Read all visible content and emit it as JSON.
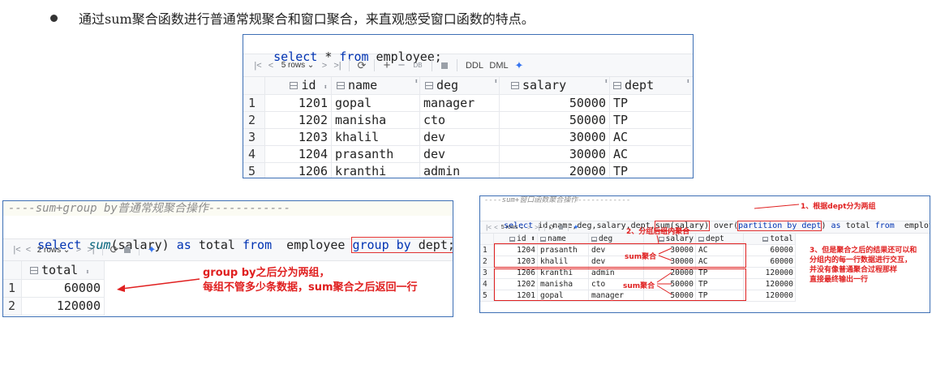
{
  "intro": "通过sum聚合函数进行普通常规聚合和窗口聚合，来直观感受窗口函数的特点。",
  "top": {
    "sql": [
      "select",
      " * ",
      "from",
      " employee;"
    ],
    "toolbar": {
      "rows": "5 rows",
      "ddl": "DDL",
      "dml": "DML"
    },
    "columns": [
      "id",
      "name",
      "deg",
      "salary",
      "dept"
    ],
    "rows": [
      [
        "1",
        "1201",
        "gopal",
        "manager",
        "50000",
        "TP"
      ],
      [
        "2",
        "1202",
        "manisha",
        "cto",
        "50000",
        "TP"
      ],
      [
        "3",
        "1203",
        "khalil",
        "dev",
        "30000",
        "AC"
      ],
      [
        "4",
        "1204",
        "prasanth",
        "dev",
        "30000",
        "AC"
      ],
      [
        "5",
        "1206",
        "kranthi",
        "admin",
        "20000",
        "TP"
      ]
    ]
  },
  "left": {
    "comment": "----sum+group by普通常规聚合操作------------",
    "sql": {
      "select": "select",
      "fn": "sum",
      "arg": "(salary)",
      "as": " as ",
      "alias": "total",
      "from": " from ",
      "table": " employee ",
      "group": "group by",
      "dept": " dept",
      "semi": ";"
    },
    "toolbar": {
      "rows": "2 rows"
    },
    "column": "total",
    "rows": [
      [
        "1",
        "60000"
      ],
      [
        "2",
        "120000"
      ]
    ],
    "annotation": [
      "group by之后分为两组，",
      "每组不管多少条数据，sum聚合之后返回一行"
    ]
  },
  "right": {
    "comment": "----sum+窗口函数聚合操作------------",
    "sql": {
      "select": "select",
      "cols": " id,name,deg,salary,dept,",
      "sum": "sum(salary)",
      "over": " over(",
      "partition": "partition by dept",
      "close": ")",
      "as": " as ",
      "total": "total",
      "from": " from ",
      "table": "employee;"
    },
    "toolbar": {
      "rows": "5 rows"
    },
    "columns": [
      "id",
      "name",
      "deg",
      "salary",
      "dept",
      "total"
    ],
    "rows": [
      [
        "1",
        "1204",
        "prasanth",
        "dev",
        "30000",
        "AC",
        "60000"
      ],
      [
        "2",
        "1203",
        "khalil",
        "dev",
        "30000",
        "AC",
        "60000"
      ],
      [
        "3",
        "1206",
        "kranthi",
        "admin",
        "20000",
        "TP",
        "120000"
      ],
      [
        "4",
        "1202",
        "manisha",
        "cto",
        "50000",
        "TP",
        "120000"
      ],
      [
        "5",
        "1201",
        "gopal",
        "manager",
        "50000",
        "TP",
        "120000"
      ]
    ],
    "ann1": "1、根据dept分为两组",
    "ann2": "2、分组后组内聚合",
    "ann3": [
      "3、但是聚合之后的结果还可以和",
      "分组内的每一行数据进行交互，",
      "并没有像普通聚合过程那样",
      "直接最终输出一行"
    ],
    "sum_label_1": "sum聚合",
    "sum_label_2": "sum聚合"
  },
  "colors": {
    "accent_red": "#e02020",
    "keyword": "#0033b3",
    "frame": "#3d6fb5"
  }
}
